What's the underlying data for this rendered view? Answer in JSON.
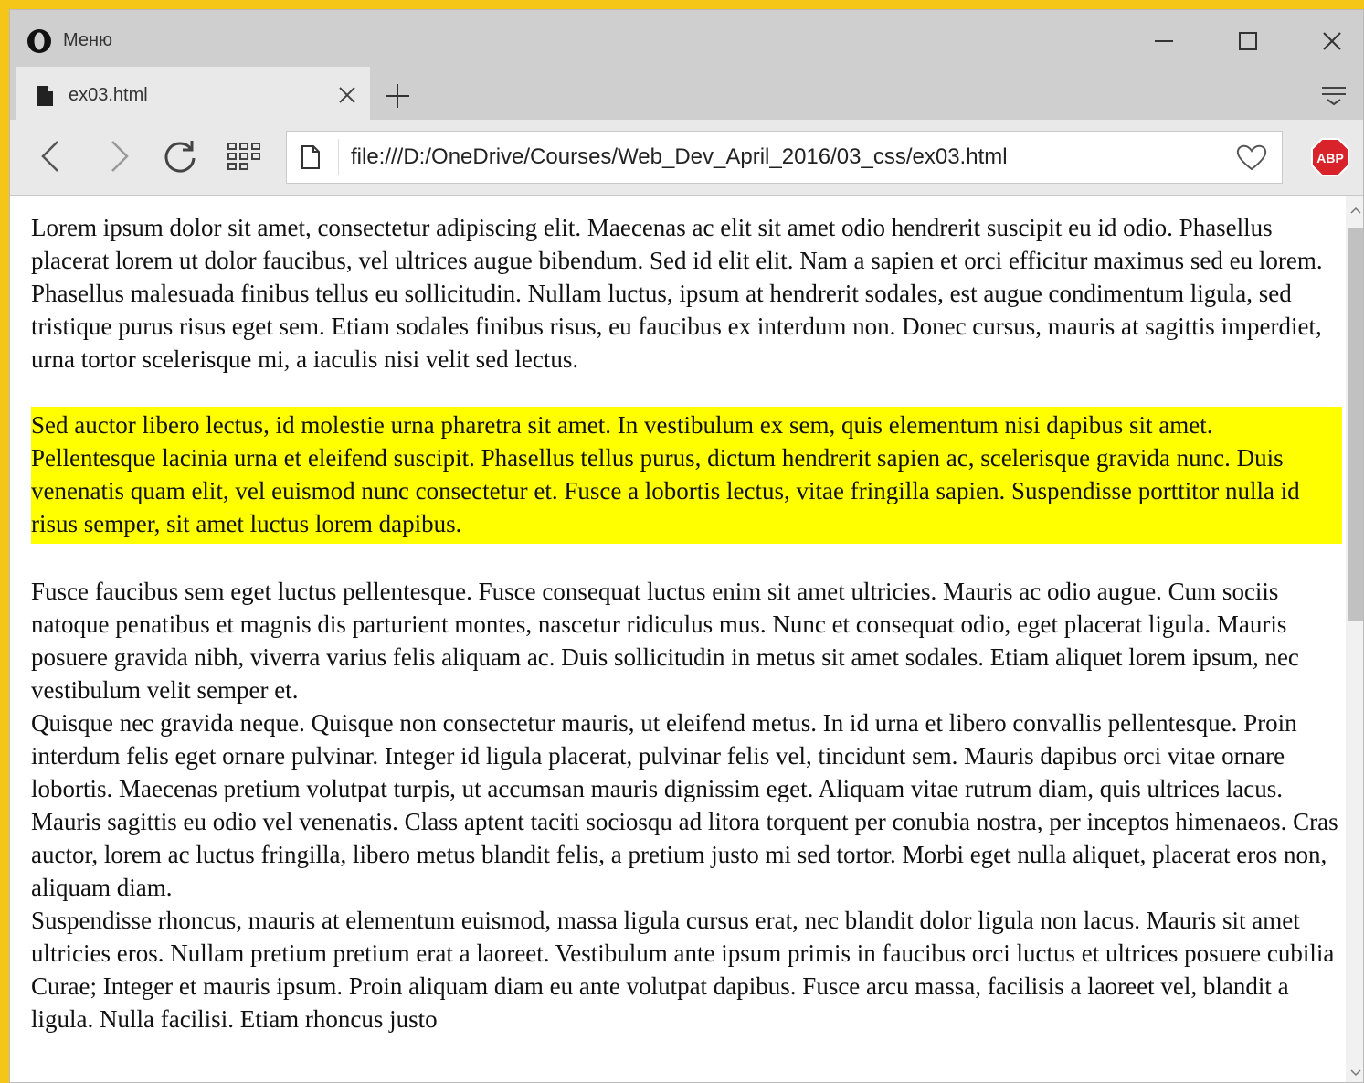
{
  "browser": {
    "menu_label": "Меню",
    "tab": {
      "title": "ex03.html"
    },
    "url": "file:///D:/OneDrive/Courses/Web_Dev_April_2016/03_css/ex03.html",
    "icons": [
      "opera-logo",
      "minimize-icon",
      "maximize-icon",
      "close-icon",
      "file-icon",
      "plus-icon",
      "tab-menu-icon",
      "back-icon",
      "forward-icon",
      "reload-icon",
      "speed-dial-icon",
      "page-icon",
      "heart-icon",
      "adblock-plus-icon"
    ],
    "adblock_label": "ABP",
    "colors": {
      "highlight": "#ffff00",
      "chrome": "#cfcfcf",
      "toolbar": "#e9e9e9",
      "abp_red": "#d8232a"
    }
  },
  "content": {
    "paragraphs": [
      "Lorem ipsum dolor sit amet, consectetur adipiscing elit. Maecenas ac elit sit amet odio hendrerit suscipit eu id odio. Phasellus placerat lorem ut dolor faucibus, vel ultrices augue bibendum. Sed id elit elit. Nam a sapien et orci efficitur maximus sed eu lorem. Phasellus malesuada finibus tellus eu sollicitudin. Nullam luctus, ipsum at hendrerit sodales, est augue condimentum ligula, sed tristique purus risus eget sem. Etiam sodales finibus risus, eu faucibus ex interdum non. Donec cursus, mauris at sagittis imperdiet, urna tortor scelerisque mi, a iaculis nisi velit sed lectus.",
      "Sed auctor libero lectus, id molestie urna pharetra sit amet. In vestibulum ex sem, quis elementum nisi dapibus sit amet. Pellentesque lacinia urna et eleifend suscipit. Phasellus tellus purus, dictum hendrerit sapien ac, scelerisque gravida nunc. Duis venenatis quam elit, vel euismod nunc consectetur et. Fusce a lobortis lectus, vitae fringilla sapien. Suspendisse porttitor nulla id risus semper, sit amet luctus lorem dapibus.",
      "Fusce faucibus sem eget luctus pellentesque. Fusce consequat luctus enim sit amet ultricies. Mauris ac odio augue. Cum sociis natoque penatibus et magnis dis parturient montes, nascetur ridiculus mus. Nunc et consequat odio, eget placerat ligula. Mauris posuere gravida nibh, viverra varius felis aliquam ac. Duis sollicitudin in metus sit amet sodales. Etiam aliquet lorem ipsum, nec vestibulum velit semper et.",
      "Quisque nec gravida neque. Quisque non consectetur mauris, ut eleifend metus. In id urna et libero convallis pellentesque. Proin interdum felis eget ornare pulvinar. Integer id ligula placerat, pulvinar felis vel, tincidunt sem. Mauris dapibus orci vitae ornare lobortis. Maecenas pretium volutpat turpis, ut accumsan mauris dignissim eget. Aliquam vitae rutrum diam, quis ultrices lacus. Mauris sagittis eu odio vel venenatis. Class aptent taciti sociosqu ad litora torquent per conubia nostra, per inceptos himenaeos. Cras auctor, lorem ac luctus fringilla, libero metus blandit felis, a pretium justo mi sed tortor. Morbi eget nulla aliquet, placerat eros non, aliquam diam.",
      "Suspendisse rhoncus, mauris at elementum euismod, massa ligula cursus erat, nec blandit dolor ligula non lacus. Mauris sit amet ultricies eros. Nullam pretium pretium erat a laoreet. Vestibulum ante ipsum primis in faucibus orci luctus et ultrices posuere cubilia Curae; Integer et mauris ipsum. Proin aliquam diam eu ante volutpat dapibus. Fusce arcu massa, facilisis a laoreet vel, blandit a ligula. Nulla facilisi. Etiam rhoncus justo"
    ]
  }
}
